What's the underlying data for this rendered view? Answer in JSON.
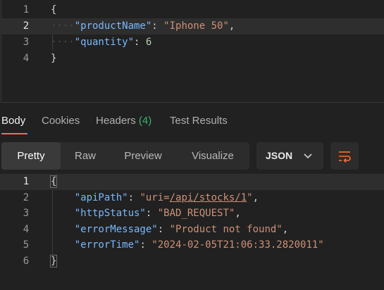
{
  "request_body": {
    "lines": [
      {
        "num": "1",
        "segments": [
          {
            "t": "{",
            "c": "punct"
          }
        ]
      },
      {
        "num": "2",
        "segments": [
          {
            "t": "····",
            "c": "dots"
          },
          {
            "t": "\"productName\"",
            "c": "key"
          },
          {
            "t": ": ",
            "c": "punct"
          },
          {
            "t": "\"Iphone 50\"",
            "c": "str"
          },
          {
            "t": ",",
            "c": "punct"
          }
        ]
      },
      {
        "num": "3",
        "segments": [
          {
            "t": "····",
            "c": "dots"
          },
          {
            "t": "\"quantity\"",
            "c": "key"
          },
          {
            "t": ": ",
            "c": "punct"
          },
          {
            "t": "6",
            "c": "num"
          }
        ]
      },
      {
        "num": "4",
        "segments": [
          {
            "t": "}",
            "c": "punct"
          }
        ]
      }
    ],
    "active_line": "2"
  },
  "response_tabs": {
    "body": "Body",
    "cookies": "Cookies",
    "headers": "Headers",
    "headers_count": "(4)",
    "test_results": "Test Results"
  },
  "toolbar": {
    "pretty": "Pretty",
    "raw": "Raw",
    "preview": "Preview",
    "visualize": "Visualize",
    "format_select": "JSON",
    "wrap_icon": "wrap-lines-icon",
    "chevron_icon": "chevron-down-icon"
  },
  "response_body": {
    "lines": [
      {
        "num": "1",
        "segments": [
          {
            "t": "{",
            "c": "punct"
          }
        ]
      },
      {
        "num": "2",
        "segments": [
          {
            "t": "    ",
            "c": "punct"
          },
          {
            "t": "\"apiPath\"",
            "c": "key"
          },
          {
            "t": ": ",
            "c": "punct"
          },
          {
            "t": "\"uri=",
            "c": "str"
          },
          {
            "t": "/api/stocks/1",
            "c": "str underline"
          },
          {
            "t": "\"",
            "c": "str"
          },
          {
            "t": ",",
            "c": "punct"
          }
        ]
      },
      {
        "num": "3",
        "segments": [
          {
            "t": "    ",
            "c": "punct"
          },
          {
            "t": "\"httpStatus\"",
            "c": "key"
          },
          {
            "t": ": ",
            "c": "punct"
          },
          {
            "t": "\"BAD_REQUEST\"",
            "c": "str"
          },
          {
            "t": ",",
            "c": "punct"
          }
        ]
      },
      {
        "num": "4",
        "segments": [
          {
            "t": "    ",
            "c": "punct"
          },
          {
            "t": "\"errorMessage\"",
            "c": "key"
          },
          {
            "t": ": ",
            "c": "punct"
          },
          {
            "t": "\"Product not found\"",
            "c": "str"
          },
          {
            "t": ",",
            "c": "punct"
          }
        ]
      },
      {
        "num": "5",
        "segments": [
          {
            "t": "    ",
            "c": "punct"
          },
          {
            "t": "\"errorTime\"",
            "c": "key"
          },
          {
            "t": ": ",
            "c": "punct"
          },
          {
            "t": "\"2024-02-05T21:06:33.2820011\"",
            "c": "str"
          }
        ]
      },
      {
        "num": "6",
        "segments": [
          {
            "t": "}",
            "c": "punct"
          }
        ]
      }
    ],
    "active_line": "1"
  },
  "colors": {
    "background": "#212121",
    "accent": "#ff6c37",
    "key": "#79b8ff",
    "string": "#ce9178",
    "number": "#b5cea8",
    "count_green": "#3cb371"
  }
}
